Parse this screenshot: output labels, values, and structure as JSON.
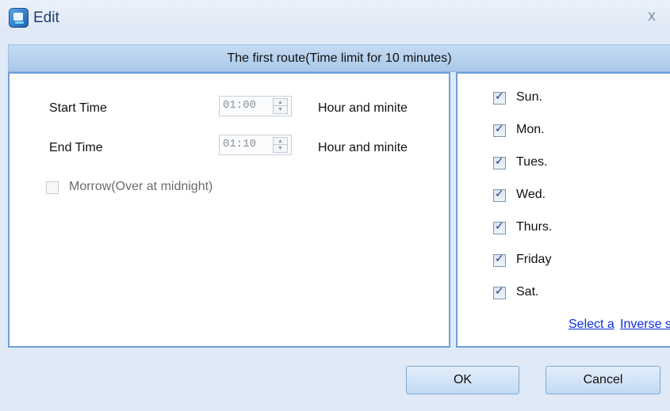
{
  "window": {
    "title": "Edit",
    "icon": "app-icon",
    "close_symbol": "x"
  },
  "route_header": "The first route(Time limit for 10 minutes)",
  "time": {
    "start_label": "Start Time",
    "start_value": "01:00",
    "start_unit": "Hour and minite",
    "end_label": "End Time",
    "end_value": "01:10",
    "end_unit": "Hour and minite",
    "morrow_label": "Morrow(Over at midnight)",
    "morrow_checked": false
  },
  "days": [
    {
      "label": "Sun.",
      "checked": true
    },
    {
      "label": "Mon.",
      "checked": true
    },
    {
      "label": "Tues.",
      "checked": true
    },
    {
      "label": "Wed.",
      "checked": true
    },
    {
      "label": "Thurs.",
      "checked": true
    },
    {
      "label": "Friday",
      "checked": true
    },
    {
      "label": "Sat.",
      "checked": true
    }
  ],
  "links": {
    "select_all": "Select a",
    "inverse_select": "Inverse se"
  },
  "buttons": {
    "ok": "OK",
    "cancel": "Cancel"
  },
  "colors": {
    "accent": "#6d9fd8",
    "link": "#0a2de0"
  }
}
